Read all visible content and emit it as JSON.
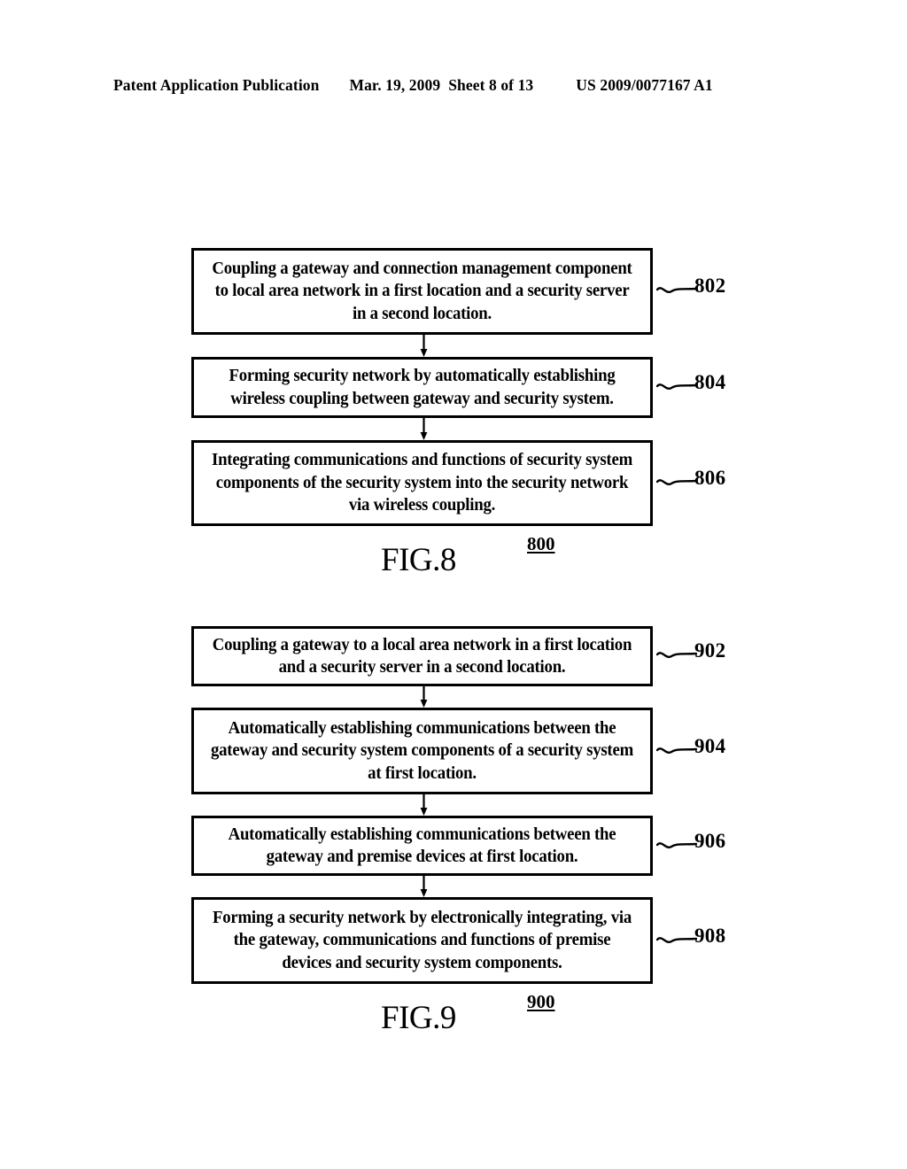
{
  "header": {
    "publication": "Patent Application Publication",
    "date": "Mar. 19, 2009",
    "sheet": "Sheet 8 of 13",
    "patent_number": "US 2009/0077167 A1"
  },
  "figures": [
    {
      "id": "figure-8",
      "label": "FIG.8",
      "number": "800",
      "steps": [
        {
          "ref": "802",
          "text": "Coupling a gateway and connection management component to local area network in a first location and a security server in a second location."
        },
        {
          "ref": "804",
          "text": "Forming security network by automatically establishing wireless coupling between gateway and security system."
        },
        {
          "ref": "806",
          "text": "Integrating communications and functions of security system components of the security system into the security network via wireless coupling."
        }
      ]
    },
    {
      "id": "figure-9",
      "label": "FIG.9",
      "number": "900",
      "steps": [
        {
          "ref": "902",
          "text": "Coupling a gateway to a local area network in a first location and a security server in a second location."
        },
        {
          "ref": "904",
          "text": "Automatically establishing communications between the gateway and security system components of a security system at first location."
        },
        {
          "ref": "906",
          "text": "Automatically establishing communications between the gateway and premise devices at first location."
        },
        {
          "ref": "908",
          "text": "Forming a security network by electronically integrating, via the gateway, communications and functions of premise devices and security system components."
        }
      ]
    }
  ],
  "colors": {
    "ink": "#000000",
    "page": "#ffffff"
  }
}
